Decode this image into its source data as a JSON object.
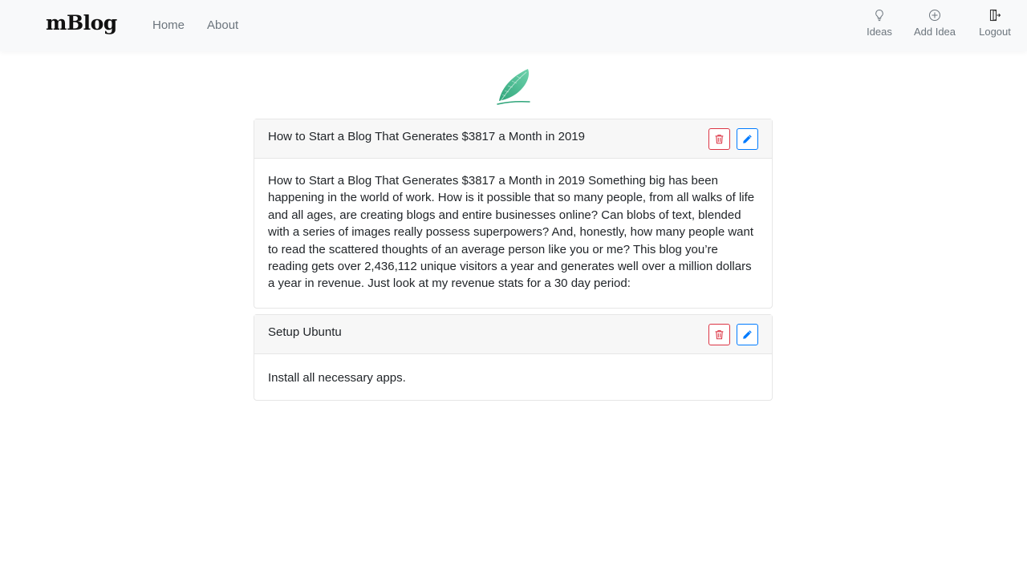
{
  "navbar": {
    "brand": "mBlog",
    "links": [
      {
        "label": "Home"
      },
      {
        "label": "About"
      }
    ],
    "actions": [
      {
        "label": "Ideas",
        "icon": "lightbulb-icon"
      },
      {
        "label": "Add Idea",
        "icon": "plus-circle-icon"
      },
      {
        "label": "Logout",
        "icon": "logout-icon"
      }
    ]
  },
  "logo": {
    "icon": "feather-icon",
    "color": "#3dbb8f"
  },
  "posts": [
    {
      "title": "How to Start a Blog That Generates $3817 a Month in 2019",
      "body": "How to Start a Blog That Generates $3817 a Month in 2019 Something big has been happening in the world of work. How is it possible that so many people, from all walks of life and all ages, are creating blogs and entire businesses online? Can blobs of text, blended with a series of images really possess superpowers? And, honestly, how many people want to read the scattered thoughts of an average person like you or me? This blog you’re reading gets over 2,436,112 unique visitors a year and generates well over a million dollars a year in revenue. Just look at my revenue stats for a 30 day period:",
      "delete_icon": "trash-icon",
      "edit_icon": "pencil-icon"
    },
    {
      "title": "Setup Ubuntu",
      "body": "Install all necessary apps.",
      "delete_icon": "trash-icon",
      "edit_icon": "pencil-icon"
    }
  ],
  "colors": {
    "danger": "#dc3545",
    "primary": "#007bff",
    "navbar_bg": "#f8f9fa",
    "muted": "#6c757d"
  }
}
